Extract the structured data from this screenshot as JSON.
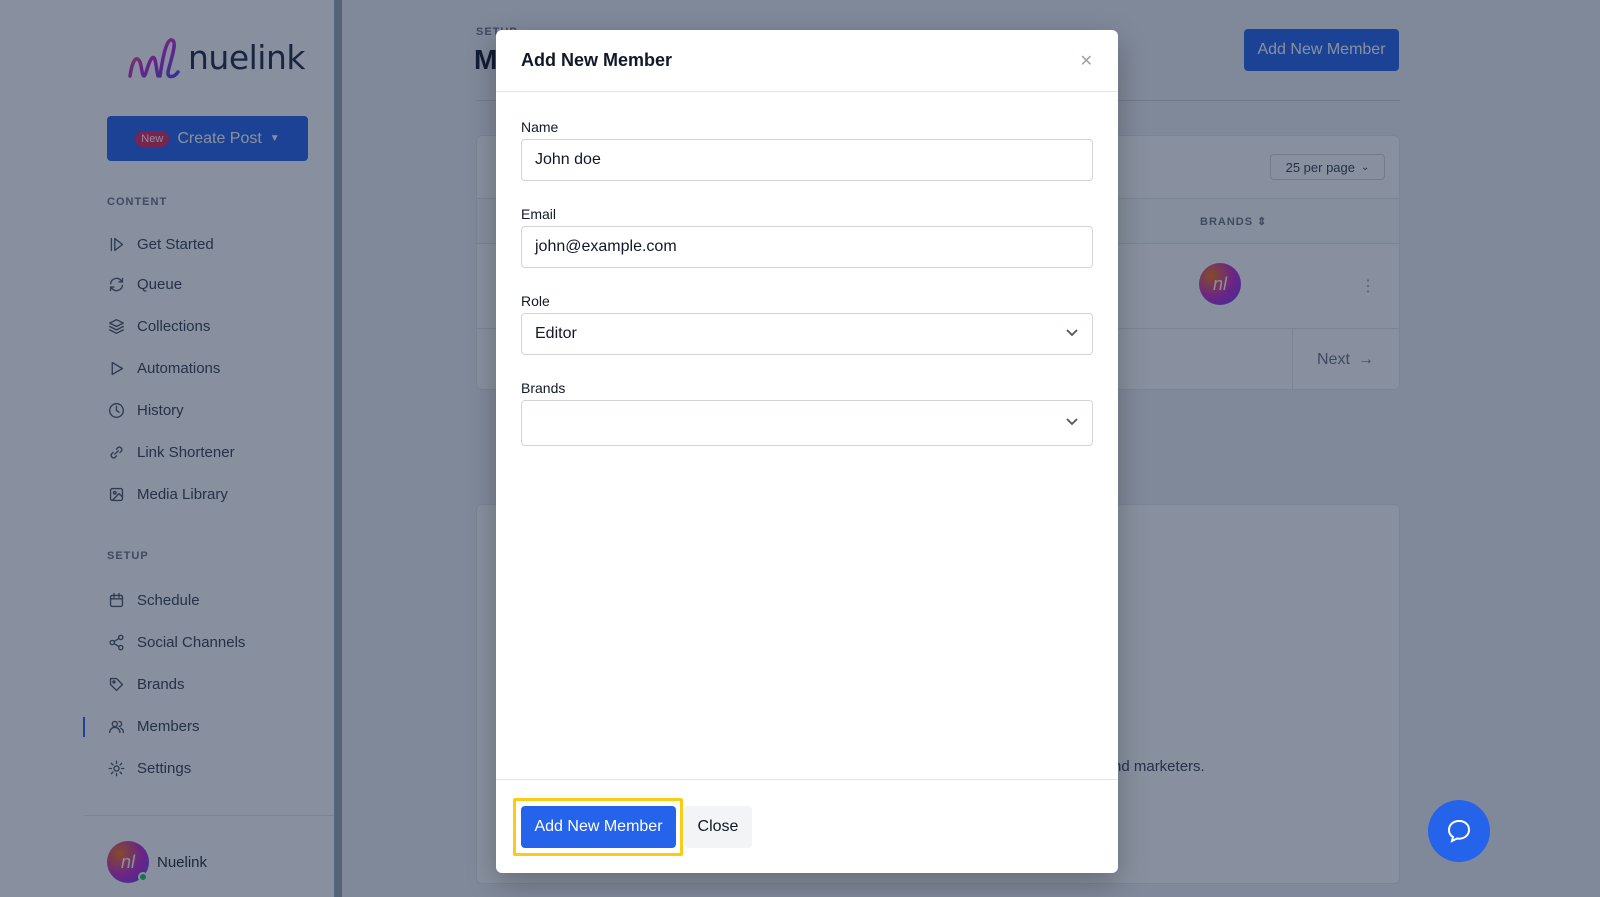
{
  "brand": {
    "name": "nuelink",
    "mark": "nl"
  },
  "sidebar": {
    "create_post": {
      "badge": "New",
      "label": "Create Post"
    },
    "sections": [
      {
        "label": "CONTENT"
      },
      {
        "label": "SETUP"
      }
    ],
    "content_items": [
      {
        "label": "Get Started",
        "icon": "play-skip-icon"
      },
      {
        "label": "Queue",
        "icon": "refresh-icon"
      },
      {
        "label": "Collections",
        "icon": "layers-icon"
      },
      {
        "label": "Automations",
        "icon": "play-icon"
      },
      {
        "label": "History",
        "icon": "clock-icon"
      },
      {
        "label": "Link Shortener",
        "icon": "link-icon"
      },
      {
        "label": "Media Library",
        "icon": "image-icon"
      }
    ],
    "setup_items": [
      {
        "label": "Schedule",
        "icon": "calendar-icon"
      },
      {
        "label": "Social Channels",
        "icon": "share-icon"
      },
      {
        "label": "Brands",
        "icon": "tag-icon"
      },
      {
        "label": "Members",
        "icon": "users-icon",
        "active": true
      },
      {
        "label": "Settings",
        "icon": "gear-icon"
      }
    ],
    "user": {
      "name": "Nuelink",
      "initials": "nl"
    }
  },
  "main": {
    "section": "SETUP",
    "title": "M",
    "add_button": "Add New Member",
    "per_page": "25 per page",
    "columns": {
      "brands": "BRANDS"
    },
    "row_brand_initials": "nl",
    "next_label": "Next",
    "card2_text": "nd marketers."
  },
  "modal": {
    "title": "Add New Member",
    "fields": {
      "name": {
        "label": "Name",
        "value": "John doe"
      },
      "email": {
        "label": "Email",
        "value": "john@example.com"
      },
      "role": {
        "label": "Role",
        "value": "Editor"
      },
      "brands": {
        "label": "Brands",
        "value": ""
      }
    },
    "submit_label": "Add New Member",
    "close_label": "Close"
  },
  "colors": {
    "accent": "#2563eb",
    "highlight": "#facc15",
    "badge": "#e0245e"
  }
}
